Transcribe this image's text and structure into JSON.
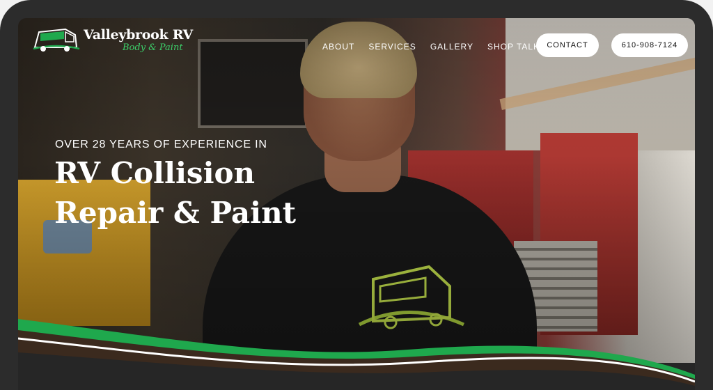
{
  "brand": {
    "name": "Valleybrook RV",
    "tagline": "Body & Paint",
    "logo_icon": "rv-bus-icon"
  },
  "nav": {
    "links": [
      "ABOUT",
      "SERVICES",
      "GALLERY",
      "SHOP TALK"
    ],
    "contact_label": "CONTACT",
    "phone_label": "610-908-7124"
  },
  "hero": {
    "eyebrow": "OVER 28 YEARS OF EXPERIENCE IN",
    "headline_line1": "RV Collision",
    "headline_line2": "Repair & Paint"
  },
  "colors": {
    "accent_green": "#1fa84d",
    "wave_brown": "#3b2a1e",
    "text": "#ffffff",
    "button_bg": "#ffffff"
  }
}
